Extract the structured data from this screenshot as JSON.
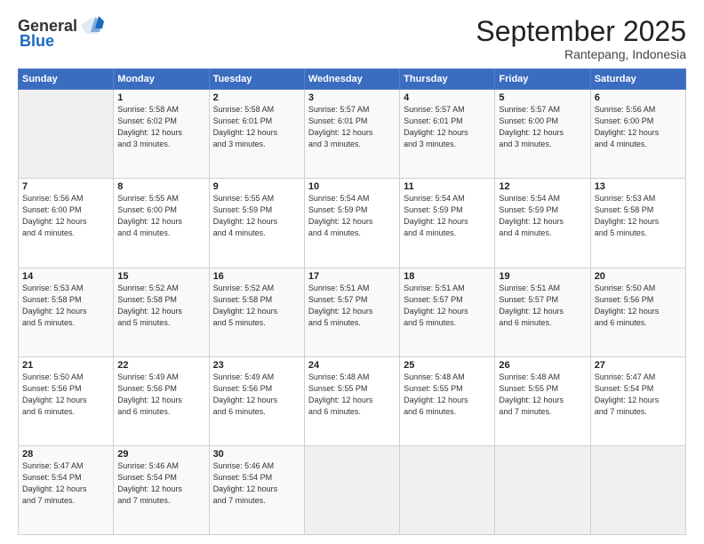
{
  "header": {
    "logo_general": "General",
    "logo_blue": "Blue",
    "title": "September 2025",
    "subtitle": "Rantepang, Indonesia"
  },
  "columns": [
    "Sunday",
    "Monday",
    "Tuesday",
    "Wednesday",
    "Thursday",
    "Friday",
    "Saturday"
  ],
  "weeks": [
    [
      {
        "day": "",
        "detail": ""
      },
      {
        "day": "1",
        "detail": "Sunrise: 5:58 AM\nSunset: 6:02 PM\nDaylight: 12 hours\nand 3 minutes."
      },
      {
        "day": "2",
        "detail": "Sunrise: 5:58 AM\nSunset: 6:01 PM\nDaylight: 12 hours\nand 3 minutes."
      },
      {
        "day": "3",
        "detail": "Sunrise: 5:57 AM\nSunset: 6:01 PM\nDaylight: 12 hours\nand 3 minutes."
      },
      {
        "day": "4",
        "detail": "Sunrise: 5:57 AM\nSunset: 6:01 PM\nDaylight: 12 hours\nand 3 minutes."
      },
      {
        "day": "5",
        "detail": "Sunrise: 5:57 AM\nSunset: 6:00 PM\nDaylight: 12 hours\nand 3 minutes."
      },
      {
        "day": "6",
        "detail": "Sunrise: 5:56 AM\nSunset: 6:00 PM\nDaylight: 12 hours\nand 4 minutes."
      }
    ],
    [
      {
        "day": "7",
        "detail": "Sunrise: 5:56 AM\nSunset: 6:00 PM\nDaylight: 12 hours\nand 4 minutes."
      },
      {
        "day": "8",
        "detail": "Sunrise: 5:55 AM\nSunset: 6:00 PM\nDaylight: 12 hours\nand 4 minutes."
      },
      {
        "day": "9",
        "detail": "Sunrise: 5:55 AM\nSunset: 5:59 PM\nDaylight: 12 hours\nand 4 minutes."
      },
      {
        "day": "10",
        "detail": "Sunrise: 5:54 AM\nSunset: 5:59 PM\nDaylight: 12 hours\nand 4 minutes."
      },
      {
        "day": "11",
        "detail": "Sunrise: 5:54 AM\nSunset: 5:59 PM\nDaylight: 12 hours\nand 4 minutes."
      },
      {
        "day": "12",
        "detail": "Sunrise: 5:54 AM\nSunset: 5:59 PM\nDaylight: 12 hours\nand 4 minutes."
      },
      {
        "day": "13",
        "detail": "Sunrise: 5:53 AM\nSunset: 5:58 PM\nDaylight: 12 hours\nand 5 minutes."
      }
    ],
    [
      {
        "day": "14",
        "detail": "Sunrise: 5:53 AM\nSunset: 5:58 PM\nDaylight: 12 hours\nand 5 minutes."
      },
      {
        "day": "15",
        "detail": "Sunrise: 5:52 AM\nSunset: 5:58 PM\nDaylight: 12 hours\nand 5 minutes."
      },
      {
        "day": "16",
        "detail": "Sunrise: 5:52 AM\nSunset: 5:58 PM\nDaylight: 12 hours\nand 5 minutes."
      },
      {
        "day": "17",
        "detail": "Sunrise: 5:51 AM\nSunset: 5:57 PM\nDaylight: 12 hours\nand 5 minutes."
      },
      {
        "day": "18",
        "detail": "Sunrise: 5:51 AM\nSunset: 5:57 PM\nDaylight: 12 hours\nand 5 minutes."
      },
      {
        "day": "19",
        "detail": "Sunrise: 5:51 AM\nSunset: 5:57 PM\nDaylight: 12 hours\nand 6 minutes."
      },
      {
        "day": "20",
        "detail": "Sunrise: 5:50 AM\nSunset: 5:56 PM\nDaylight: 12 hours\nand 6 minutes."
      }
    ],
    [
      {
        "day": "21",
        "detail": "Sunrise: 5:50 AM\nSunset: 5:56 PM\nDaylight: 12 hours\nand 6 minutes."
      },
      {
        "day": "22",
        "detail": "Sunrise: 5:49 AM\nSunset: 5:56 PM\nDaylight: 12 hours\nand 6 minutes."
      },
      {
        "day": "23",
        "detail": "Sunrise: 5:49 AM\nSunset: 5:56 PM\nDaylight: 12 hours\nand 6 minutes."
      },
      {
        "day": "24",
        "detail": "Sunrise: 5:48 AM\nSunset: 5:55 PM\nDaylight: 12 hours\nand 6 minutes."
      },
      {
        "day": "25",
        "detail": "Sunrise: 5:48 AM\nSunset: 5:55 PM\nDaylight: 12 hours\nand 6 minutes."
      },
      {
        "day": "26",
        "detail": "Sunrise: 5:48 AM\nSunset: 5:55 PM\nDaylight: 12 hours\nand 7 minutes."
      },
      {
        "day": "27",
        "detail": "Sunrise: 5:47 AM\nSunset: 5:54 PM\nDaylight: 12 hours\nand 7 minutes."
      }
    ],
    [
      {
        "day": "28",
        "detail": "Sunrise: 5:47 AM\nSunset: 5:54 PM\nDaylight: 12 hours\nand 7 minutes."
      },
      {
        "day": "29",
        "detail": "Sunrise: 5:46 AM\nSunset: 5:54 PM\nDaylight: 12 hours\nand 7 minutes."
      },
      {
        "day": "30",
        "detail": "Sunrise: 5:46 AM\nSunset: 5:54 PM\nDaylight: 12 hours\nand 7 minutes."
      },
      {
        "day": "",
        "detail": ""
      },
      {
        "day": "",
        "detail": ""
      },
      {
        "day": "",
        "detail": ""
      },
      {
        "day": "",
        "detail": ""
      }
    ]
  ]
}
